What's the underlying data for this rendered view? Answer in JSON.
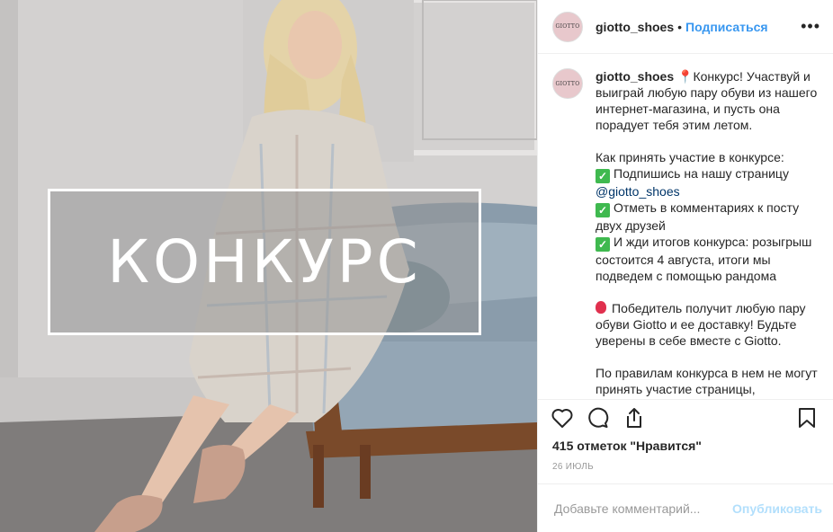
{
  "photo": {
    "overlay_text": "КОНКУРС"
  },
  "header": {
    "avatar_text": "GIOTTO",
    "username": "giotto_shoes",
    "separator": "•",
    "follow_label": "Подписаться",
    "more_label": "•••"
  },
  "caption": {
    "avatar_text": "GIOTTO",
    "username": "giotto_shoes",
    "intro": "Конкурс! Участвуй и выиграй любую пару обуви из нашего интернет-магазина, и пусть она порадует тебя этим летом.",
    "how_title": "Как принять участие в конкурсе:",
    "step1": "Подпишись на нашу страницу",
    "step1_mention": "@giotto_shoes",
    "step2": "Отметь в комментариях к посту двух друзей",
    "step3": "И жди итогов конкурса: розыгрыш состоится 4 августа, итоги мы подведем с помощью рандома",
    "winner": "Победитель получит любую пару обуви Giotto и ее доставку! Будьте уверены в себе вместе с Giotto.",
    "rules": "По правилам конкурса в нем не могут принять участие страницы,"
  },
  "actions": {
    "icons": [
      "heart-icon",
      "comment-icon",
      "share-icon",
      "bookmark-icon"
    ]
  },
  "likes_text": "415 отметок \"Нравится\"",
  "date_text": "26 июль",
  "comment": {
    "placeholder": "Добавьте комментарий...",
    "publish_label": "Опубликовать"
  },
  "colors": {
    "accent": "#3897f0",
    "publish_disabled": "#b2dffc",
    "check_green": "#3fb94f"
  }
}
